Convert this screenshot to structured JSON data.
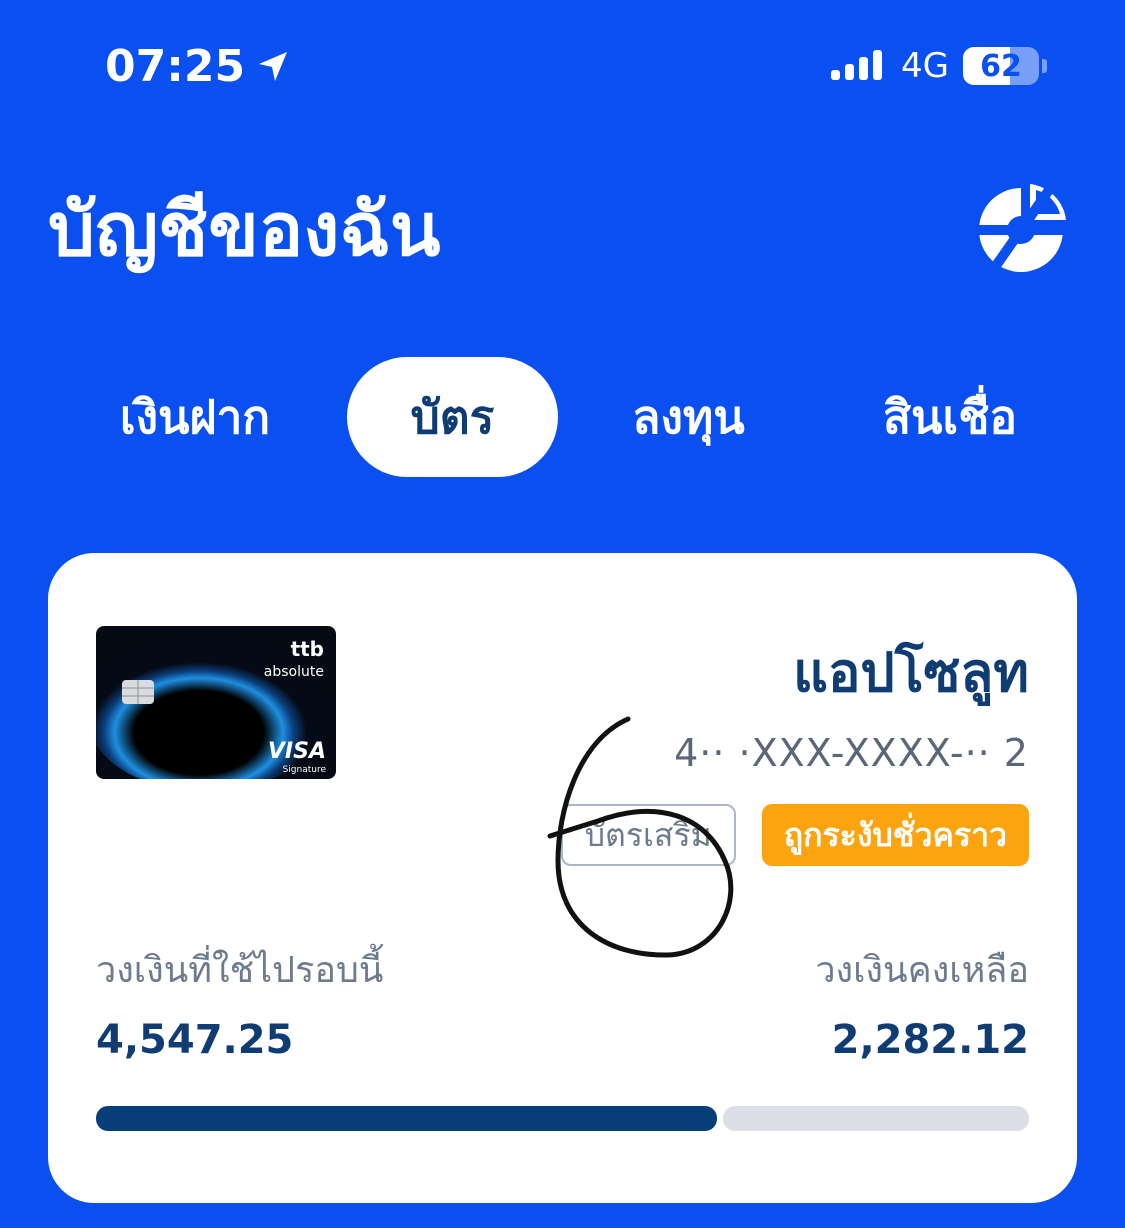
{
  "status_bar": {
    "time": "07:25",
    "network": "4G",
    "battery": "62",
    "battery_level": 0.62
  },
  "header": {
    "title": "บัญชีของฉัน",
    "portfolio_icon": "pie-chart-icon"
  },
  "tabs": [
    {
      "label": "เงินฝาก",
      "active": false
    },
    {
      "label": "บัตร",
      "active": true
    },
    {
      "label": "ลงทุน",
      "active": false
    },
    {
      "label": "สินเชื่อ",
      "active": false
    }
  ],
  "card": {
    "brand": "ttb",
    "product": "absolute",
    "network": "VISA",
    "network_tier": "Signature",
    "name": "แอปโซลูท",
    "number_masked": "4·· ·XXX-XXXX-·· 2",
    "badges": {
      "supplementary": "บัตรเสริม",
      "status": "ถูกระงับชั่วคราว"
    },
    "used_label": "วงเงินที่ใช้ไปรอบนี้",
    "used_value": "4,547.25",
    "remaining_label": "วงเงินคงเหลือ",
    "remaining_value": "2,282.12",
    "used_fraction": 0.666
  },
  "colors": {
    "background": "#0A50F0",
    "navy": "#0F3D73",
    "suspended": "#FCA40F",
    "progress_used": "#073E7A",
    "progress_track": "#DCE0E6"
  }
}
